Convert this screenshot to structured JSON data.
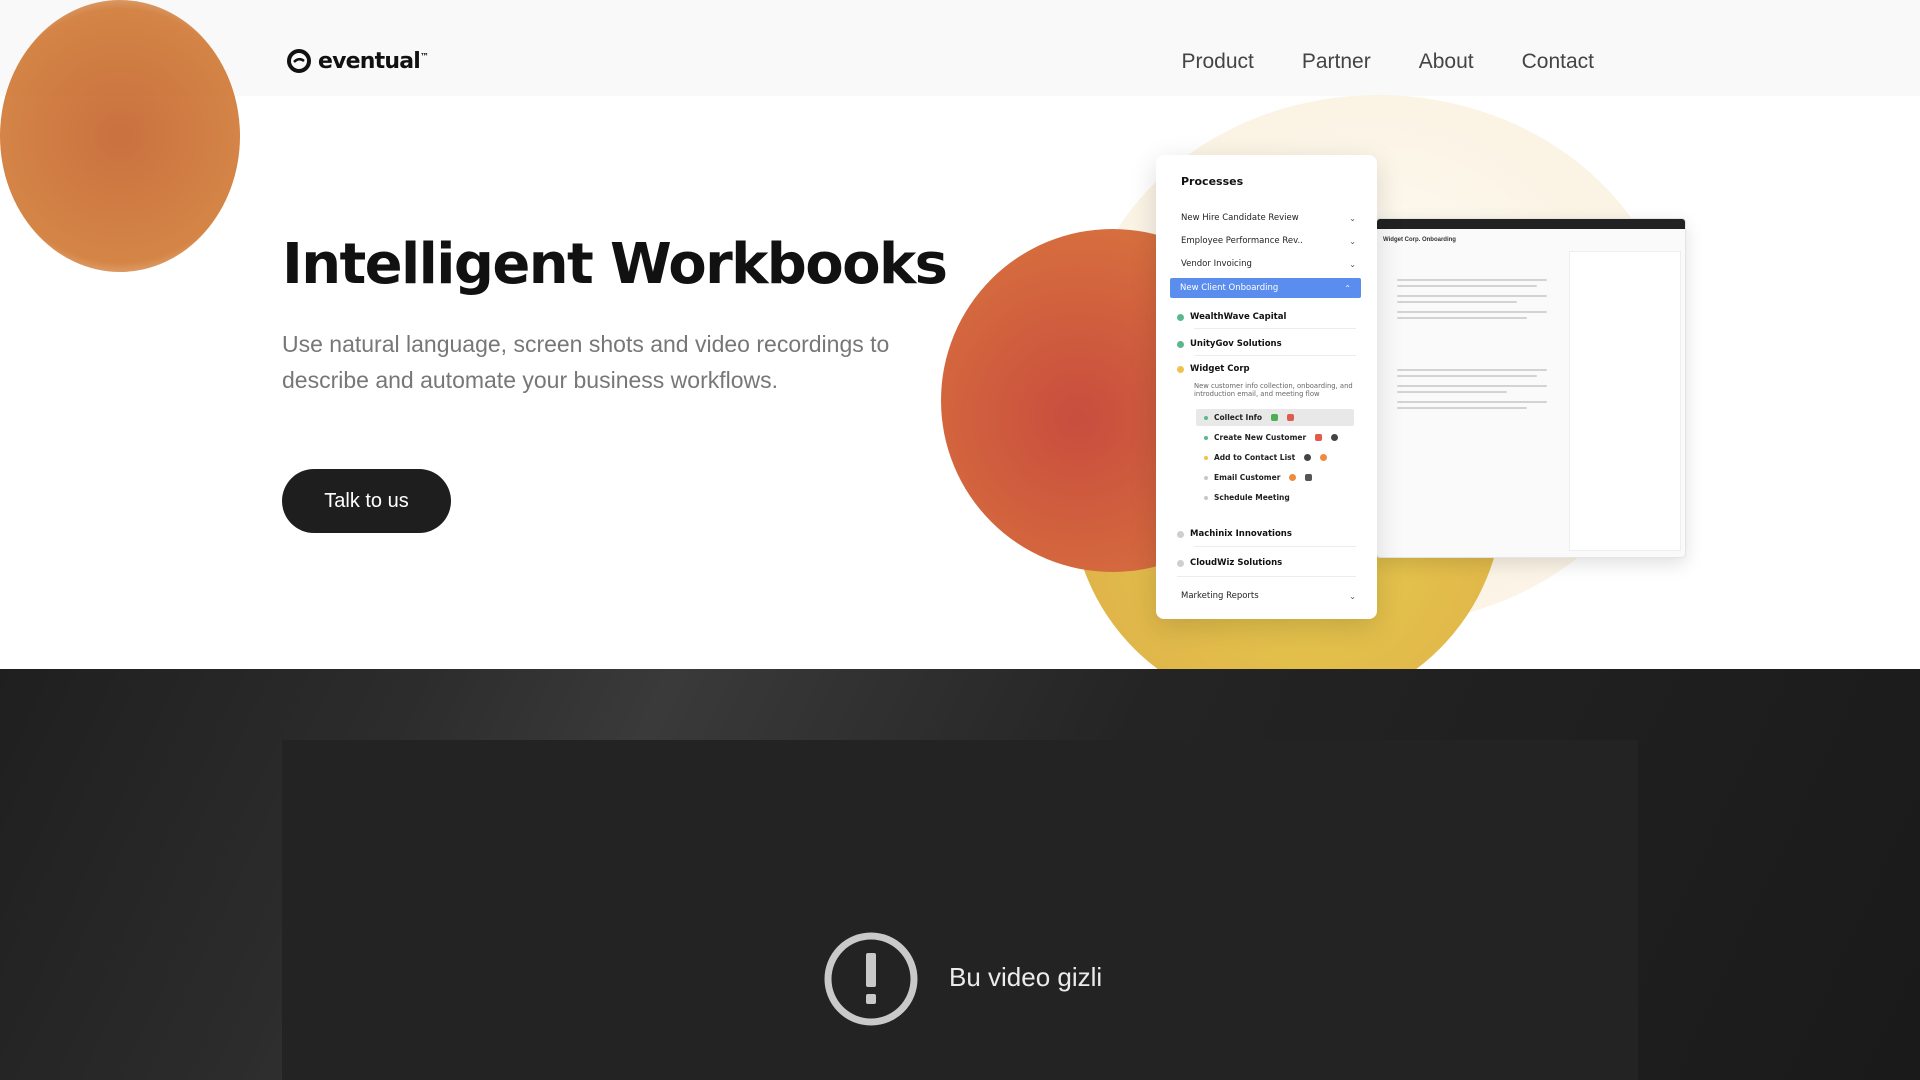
{
  "header": {
    "brand": "eventual",
    "brand_mark": "™",
    "nav": [
      "Product",
      "Partner",
      "About",
      "Contact"
    ]
  },
  "hero": {
    "title": "Intelligent Workbooks",
    "subtitle": "Use natural language, screen shots and video recordings to describe and automate your business workflows.",
    "cta_label": "Talk to us"
  },
  "processes": {
    "title": "Processes",
    "rows": [
      {
        "label": "New Hire Candidate Review",
        "icon": "chevron-down-icon"
      },
      {
        "label": "Employee Performance Rev..",
        "icon": "chevron-down-icon"
      },
      {
        "label": "Vendor Invoicing",
        "icon": "chevron-down-icon"
      }
    ],
    "active": {
      "label": "New Client Onboarding",
      "icon": "chevron-up-icon"
    },
    "clients": [
      {
        "label": "WealthWave Capital",
        "color": "#5cb88a"
      },
      {
        "label": "UnityGov Solutions",
        "color": "#5cb88a"
      },
      {
        "label": "Widget Corp",
        "color": "#f0c24b"
      }
    ],
    "widget_desc": "New customer info collection, onboarding, and introduction email, and meeting flow",
    "steps": [
      {
        "label": "Collect Info",
        "color": "#5cb88a"
      },
      {
        "label": "Create New Customer",
        "color": "#5cb88a"
      },
      {
        "label": "Add to Contact List",
        "color": "#f0c24b"
      },
      {
        "label": "Email Customer",
        "color": "#c8c8c8"
      },
      {
        "label": "Schedule Meeting",
        "color": "#c8c8c8"
      }
    ],
    "clients_more": [
      {
        "label": "Machinix Innovations",
        "color": "#cfcfcf"
      },
      {
        "label": "CloudWiz Solutions",
        "color": "#cfcfcf"
      }
    ],
    "footer_row": {
      "label": "Marketing Reports",
      "icon": "chevron-down-icon"
    }
  },
  "workbook": {
    "title": "Widget Corp. Onboarding"
  },
  "video": {
    "message": "Bu video gizli",
    "icon": "exclamation-circle-icon"
  },
  "colors": {
    "accent_blue": "#5b8def",
    "cta_bg": "#1e1e1e",
    "blob_red": "#c84d3e",
    "blob_yellow": "#e6c94d"
  }
}
